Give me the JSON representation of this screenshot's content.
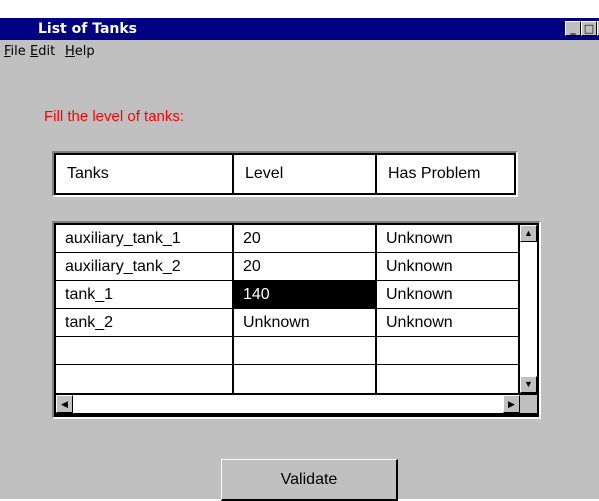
{
  "window": {
    "title": "List of Tanks"
  },
  "title_buttons": {
    "minimize": "_",
    "maximize": "□",
    "close": "X"
  },
  "menu": [
    {
      "mnemonic": "F",
      "rest": "ile"
    },
    {
      "mnemonic": "E",
      "rest": "dit"
    },
    {
      "mnemonic": "H",
      "rest": "elp"
    }
  ],
  "prompt": "Fill the level of tanks:",
  "prompt_color": "#ff0000",
  "table": {
    "columns": [
      "Tanks",
      "Level",
      "Has Problem"
    ],
    "rows": [
      [
        "auxiliary_tank_1",
        "20",
        "Unknown"
      ],
      [
        "auxiliary_tank_2",
        "20",
        "Unknown"
      ],
      [
        "tank_1",
        "140",
        "Unknown"
      ],
      [
        "tank_2",
        "Unknown",
        "Unknown"
      ],
      [
        "",
        "",
        ""
      ],
      [
        "",
        "",
        ""
      ]
    ],
    "selected_cell": {
      "row": 2,
      "col": 1
    }
  },
  "scroll_icons": {
    "up": "▲",
    "down": "▼",
    "left": "◀",
    "right": "▶"
  },
  "validate_button": "Validate",
  "colors": {
    "titlebar": "#000080",
    "window": "#c0c0c0"
  }
}
